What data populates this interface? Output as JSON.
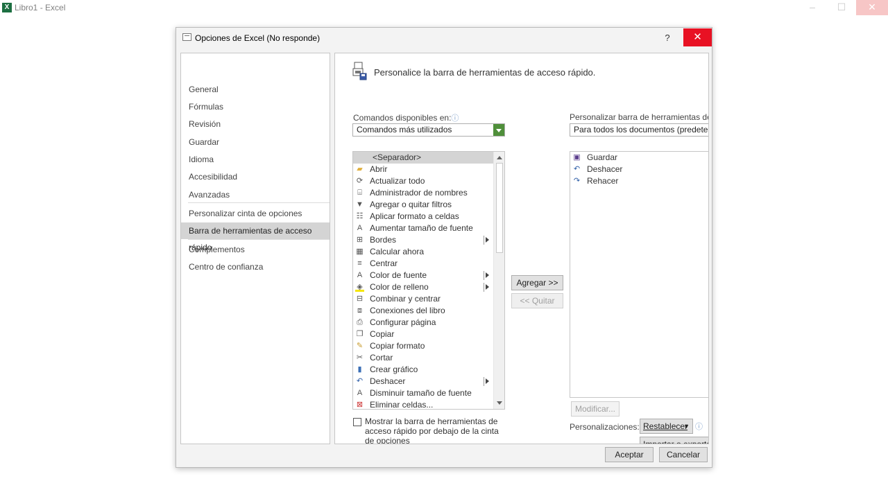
{
  "app": {
    "title": "Libro1 - Excel",
    "window_controls": {
      "minimize": "–",
      "maximize": "☐",
      "close": "✕"
    }
  },
  "dialog": {
    "title": "Opciones de Excel (No responde)",
    "help": "?",
    "close": "✕",
    "ok": "Aceptar",
    "cancel": "Cancelar"
  },
  "nav": {
    "items": [
      "General",
      "Fórmulas",
      "Revisión",
      "Guardar",
      "Idioma",
      "Accesibilidad",
      "Avanzadas",
      "Personalizar cinta de opciones",
      "Barra de herramientas de acceso rápido",
      "Complementos",
      "Centro de confianza"
    ],
    "selected": "Barra de herramientas de acceso rápido"
  },
  "content": {
    "header": "Personalice la barra de herramientas de acceso rápido.",
    "commands_label": "Comandos disponibles en:",
    "commands_value": "Comandos más utilizados",
    "customize_label": "Personalizar barra de herramientas de ac",
    "customize_value": "Para todos los documentos (predeterm",
    "commands": [
      {
        "label": "<Separador>",
        "icon": "",
        "sub": false
      },
      {
        "label": "Abrir",
        "icon": "folder-icon",
        "sub": false
      },
      {
        "label": "Actualizar todo",
        "icon": "refresh-all-icon",
        "sub": false
      },
      {
        "label": "Administrador de nombres",
        "icon": "name-manager-icon",
        "sub": false
      },
      {
        "label": "Agregar o quitar filtros",
        "icon": "filter-icon",
        "sub": false
      },
      {
        "label": "Aplicar formato a celdas",
        "icon": "format-cells-icon",
        "sub": false
      },
      {
        "label": "Aumentar tamaño de fuente",
        "icon": "increase-font-icon",
        "sub": false
      },
      {
        "label": "Bordes",
        "icon": "borders-icon",
        "sub": true
      },
      {
        "label": "Calcular ahora",
        "icon": "calculator-icon",
        "sub": false
      },
      {
        "label": "Centrar",
        "icon": "align-center-icon",
        "sub": false
      },
      {
        "label": "Color de fuente",
        "icon": "font-color-icon",
        "sub": true
      },
      {
        "label": "Color de relleno",
        "icon": "fill-color-icon",
        "sub": true
      },
      {
        "label": "Combinar y centrar",
        "icon": "merge-center-icon",
        "sub": false
      },
      {
        "label": "Conexiones del libro",
        "icon": "connections-icon",
        "sub": false
      },
      {
        "label": "Configurar página",
        "icon": "page-setup-icon",
        "sub": false
      },
      {
        "label": "Copiar",
        "icon": "copy-icon",
        "sub": false
      },
      {
        "label": "Copiar formato",
        "icon": "format-painter-icon",
        "sub": false
      },
      {
        "label": "Cortar",
        "icon": "scissors-icon",
        "sub": false
      },
      {
        "label": "Crear gráfico",
        "icon": "chart-icon",
        "sub": false
      },
      {
        "label": "Deshacer",
        "icon": "undo-icon",
        "sub": true
      },
      {
        "label": "Disminuir tamaño de fuente",
        "icon": "decrease-font-icon",
        "sub": false
      },
      {
        "label": "Eliminar celdas...",
        "icon": "delete-cells-icon",
        "sub": false
      }
    ],
    "qa_items": [
      {
        "label": "Guardar",
        "icon": "save-icon"
      },
      {
        "label": "Deshacer",
        "icon": "undo-icon"
      },
      {
        "label": "Rehacer",
        "icon": "redo-icon"
      }
    ],
    "add_button": "Agregar >>",
    "remove_button": "<< Quitar",
    "modify_button": "Modificar...",
    "checkbox_label": "Mostrar la barra de herramientas de acceso rápido por debajo de la cinta de opciones",
    "customizations_label": "Personalizaciones:",
    "reset_button": "Restablecer",
    "import_export_button": "Importar o exportar"
  },
  "colors": {
    "close_red": "#e81123",
    "dropdown_green": "#4f8f3a",
    "selection_gray": "#d4d4d4",
    "spinner_blue": "#2b8fe6"
  }
}
